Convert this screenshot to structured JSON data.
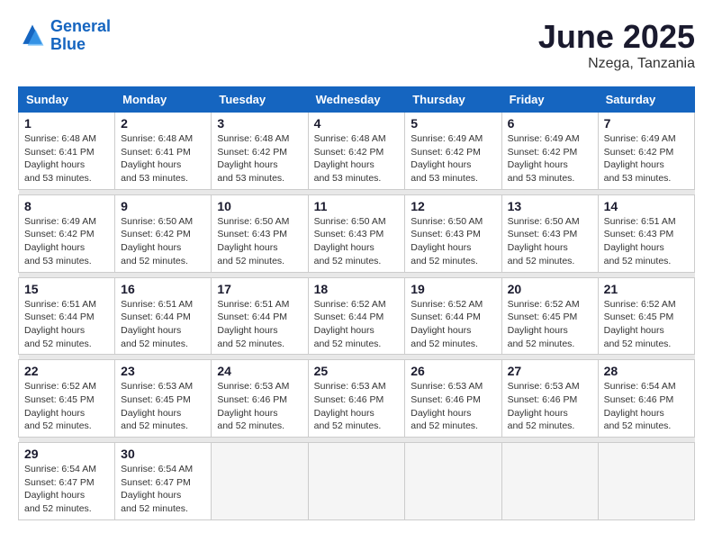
{
  "logo": {
    "line1": "General",
    "line2": "Blue"
  },
  "title": "June 2025",
  "subtitle": "Nzega, Tanzania",
  "columns": [
    "Sunday",
    "Monday",
    "Tuesday",
    "Wednesday",
    "Thursday",
    "Friday",
    "Saturday"
  ],
  "weeks": [
    [
      {
        "day": "1",
        "sunrise": "6:48 AM",
        "sunset": "6:41 PM",
        "daylight": "11 hours and 53 minutes."
      },
      {
        "day": "2",
        "sunrise": "6:48 AM",
        "sunset": "6:41 PM",
        "daylight": "11 hours and 53 minutes."
      },
      {
        "day": "3",
        "sunrise": "6:48 AM",
        "sunset": "6:42 PM",
        "daylight": "11 hours and 53 minutes."
      },
      {
        "day": "4",
        "sunrise": "6:48 AM",
        "sunset": "6:42 PM",
        "daylight": "11 hours and 53 minutes."
      },
      {
        "day": "5",
        "sunrise": "6:49 AM",
        "sunset": "6:42 PM",
        "daylight": "11 hours and 53 minutes."
      },
      {
        "day": "6",
        "sunrise": "6:49 AM",
        "sunset": "6:42 PM",
        "daylight": "11 hours and 53 minutes."
      },
      {
        "day": "7",
        "sunrise": "6:49 AM",
        "sunset": "6:42 PM",
        "daylight": "11 hours and 53 minutes."
      }
    ],
    [
      {
        "day": "8",
        "sunrise": "6:49 AM",
        "sunset": "6:42 PM",
        "daylight": "11 hours and 53 minutes."
      },
      {
        "day": "9",
        "sunrise": "6:50 AM",
        "sunset": "6:42 PM",
        "daylight": "11 hours and 52 minutes."
      },
      {
        "day": "10",
        "sunrise": "6:50 AM",
        "sunset": "6:43 PM",
        "daylight": "11 hours and 52 minutes."
      },
      {
        "day": "11",
        "sunrise": "6:50 AM",
        "sunset": "6:43 PM",
        "daylight": "11 hours and 52 minutes."
      },
      {
        "day": "12",
        "sunrise": "6:50 AM",
        "sunset": "6:43 PM",
        "daylight": "11 hours and 52 minutes."
      },
      {
        "day": "13",
        "sunrise": "6:50 AM",
        "sunset": "6:43 PM",
        "daylight": "11 hours and 52 minutes."
      },
      {
        "day": "14",
        "sunrise": "6:51 AM",
        "sunset": "6:43 PM",
        "daylight": "11 hours and 52 minutes."
      }
    ],
    [
      {
        "day": "15",
        "sunrise": "6:51 AM",
        "sunset": "6:44 PM",
        "daylight": "11 hours and 52 minutes."
      },
      {
        "day": "16",
        "sunrise": "6:51 AM",
        "sunset": "6:44 PM",
        "daylight": "11 hours and 52 minutes."
      },
      {
        "day": "17",
        "sunrise": "6:51 AM",
        "sunset": "6:44 PM",
        "daylight": "11 hours and 52 minutes."
      },
      {
        "day": "18",
        "sunrise": "6:52 AM",
        "sunset": "6:44 PM",
        "daylight": "11 hours and 52 minutes."
      },
      {
        "day": "19",
        "sunrise": "6:52 AM",
        "sunset": "6:44 PM",
        "daylight": "11 hours and 52 minutes."
      },
      {
        "day": "20",
        "sunrise": "6:52 AM",
        "sunset": "6:45 PM",
        "daylight": "11 hours and 52 minutes."
      },
      {
        "day": "21",
        "sunrise": "6:52 AM",
        "sunset": "6:45 PM",
        "daylight": "11 hours and 52 minutes."
      }
    ],
    [
      {
        "day": "22",
        "sunrise": "6:52 AM",
        "sunset": "6:45 PM",
        "daylight": "11 hours and 52 minutes."
      },
      {
        "day": "23",
        "sunrise": "6:53 AM",
        "sunset": "6:45 PM",
        "daylight": "11 hours and 52 minutes."
      },
      {
        "day": "24",
        "sunrise": "6:53 AM",
        "sunset": "6:46 PM",
        "daylight": "11 hours and 52 minutes."
      },
      {
        "day": "25",
        "sunrise": "6:53 AM",
        "sunset": "6:46 PM",
        "daylight": "11 hours and 52 minutes."
      },
      {
        "day": "26",
        "sunrise": "6:53 AM",
        "sunset": "6:46 PM",
        "daylight": "11 hours and 52 minutes."
      },
      {
        "day": "27",
        "sunrise": "6:53 AM",
        "sunset": "6:46 PM",
        "daylight": "11 hours and 52 minutes."
      },
      {
        "day": "28",
        "sunrise": "6:54 AM",
        "sunset": "6:46 PM",
        "daylight": "11 hours and 52 minutes."
      }
    ],
    [
      {
        "day": "29",
        "sunrise": "6:54 AM",
        "sunset": "6:47 PM",
        "daylight": "11 hours and 52 minutes."
      },
      {
        "day": "30",
        "sunrise": "6:54 AM",
        "sunset": "6:47 PM",
        "daylight": "11 hours and 52 minutes."
      },
      null,
      null,
      null,
      null,
      null
    ]
  ]
}
